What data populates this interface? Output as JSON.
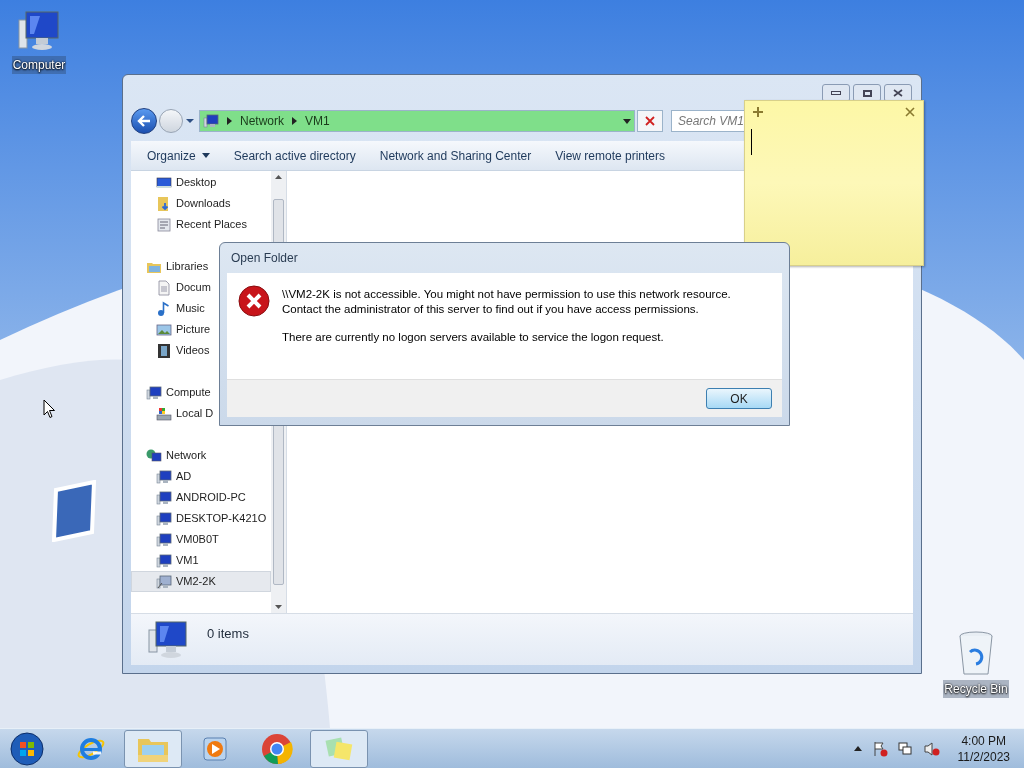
{
  "desktop_icons": [
    {
      "label": "Computer",
      "kind": "computer"
    },
    {
      "label": "Recycle Bin",
      "kind": "recycle"
    }
  ],
  "explorer": {
    "breadcrumbs": [
      "Network",
      "VM1"
    ],
    "search": {
      "placeholder": "Search VM1"
    },
    "toolbar": [
      {
        "label": "Organize",
        "dropdown": true
      },
      {
        "label": "Search active directory",
        "dropdown": false
      },
      {
        "label": "Network and Sharing Center",
        "dropdown": false
      },
      {
        "label": "View remote printers",
        "dropdown": false
      }
    ],
    "favorites": [
      {
        "label": "Desktop",
        "kind": "desktop",
        "selected": false
      },
      {
        "label": "Downloads",
        "kind": "downloads",
        "selected": false
      },
      {
        "label": "Recent Places",
        "kind": "recent",
        "selected": false
      }
    ],
    "tree": [
      {
        "label": "Libraries",
        "kind": "library",
        "selected": false,
        "children": [
          {
            "label": "Docum",
            "kind": "documents",
            "selected": false
          },
          {
            "label": "Music",
            "kind": "music",
            "selected": false
          },
          {
            "label": "Picture",
            "kind": "pictures",
            "selected": false
          },
          {
            "label": "Videos",
            "kind": "videos",
            "selected": false
          }
        ]
      },
      {
        "label": "Compute",
        "kind": "computer",
        "selected": false,
        "children": [
          {
            "label": "Local D",
            "kind": "drive",
            "selected": false
          }
        ]
      },
      {
        "label": "Network",
        "kind": "network",
        "selected": false,
        "children": [
          {
            "label": "AD",
            "kind": "pc",
            "selected": false
          },
          {
            "label": "ANDROID-PC",
            "kind": "pc",
            "selected": false
          },
          {
            "label": "DESKTOP-K421O",
            "kind": "pc",
            "selected": false
          },
          {
            "label": "VM0B0T",
            "kind": "pc",
            "selected": false
          },
          {
            "label": "VM1",
            "kind": "pc",
            "selected": false
          },
          {
            "label": "VM2-2K",
            "kind": "pc-error",
            "selected": true
          }
        ]
      }
    ],
    "status_bar": "0 items"
  },
  "dialog": {
    "title": "Open Folder",
    "messages": [
      "\\\\VM2-2K is not accessible. You might not have permission to use this network resource. Contact the administrator of this server to find out if you have access permissions.",
      "There are currently no logon servers available to service the logon request."
    ],
    "buttons": [
      "OK"
    ]
  },
  "taskbar": {
    "apps": [
      {
        "kind": "ie",
        "active": false
      },
      {
        "kind": "explorer",
        "active": true
      },
      {
        "kind": "media",
        "active": false
      },
      {
        "kind": "chrome",
        "active": false
      },
      {
        "kind": "sticky",
        "active": true
      }
    ],
    "time": "4:00 PM",
    "date": "11/2/2023"
  }
}
